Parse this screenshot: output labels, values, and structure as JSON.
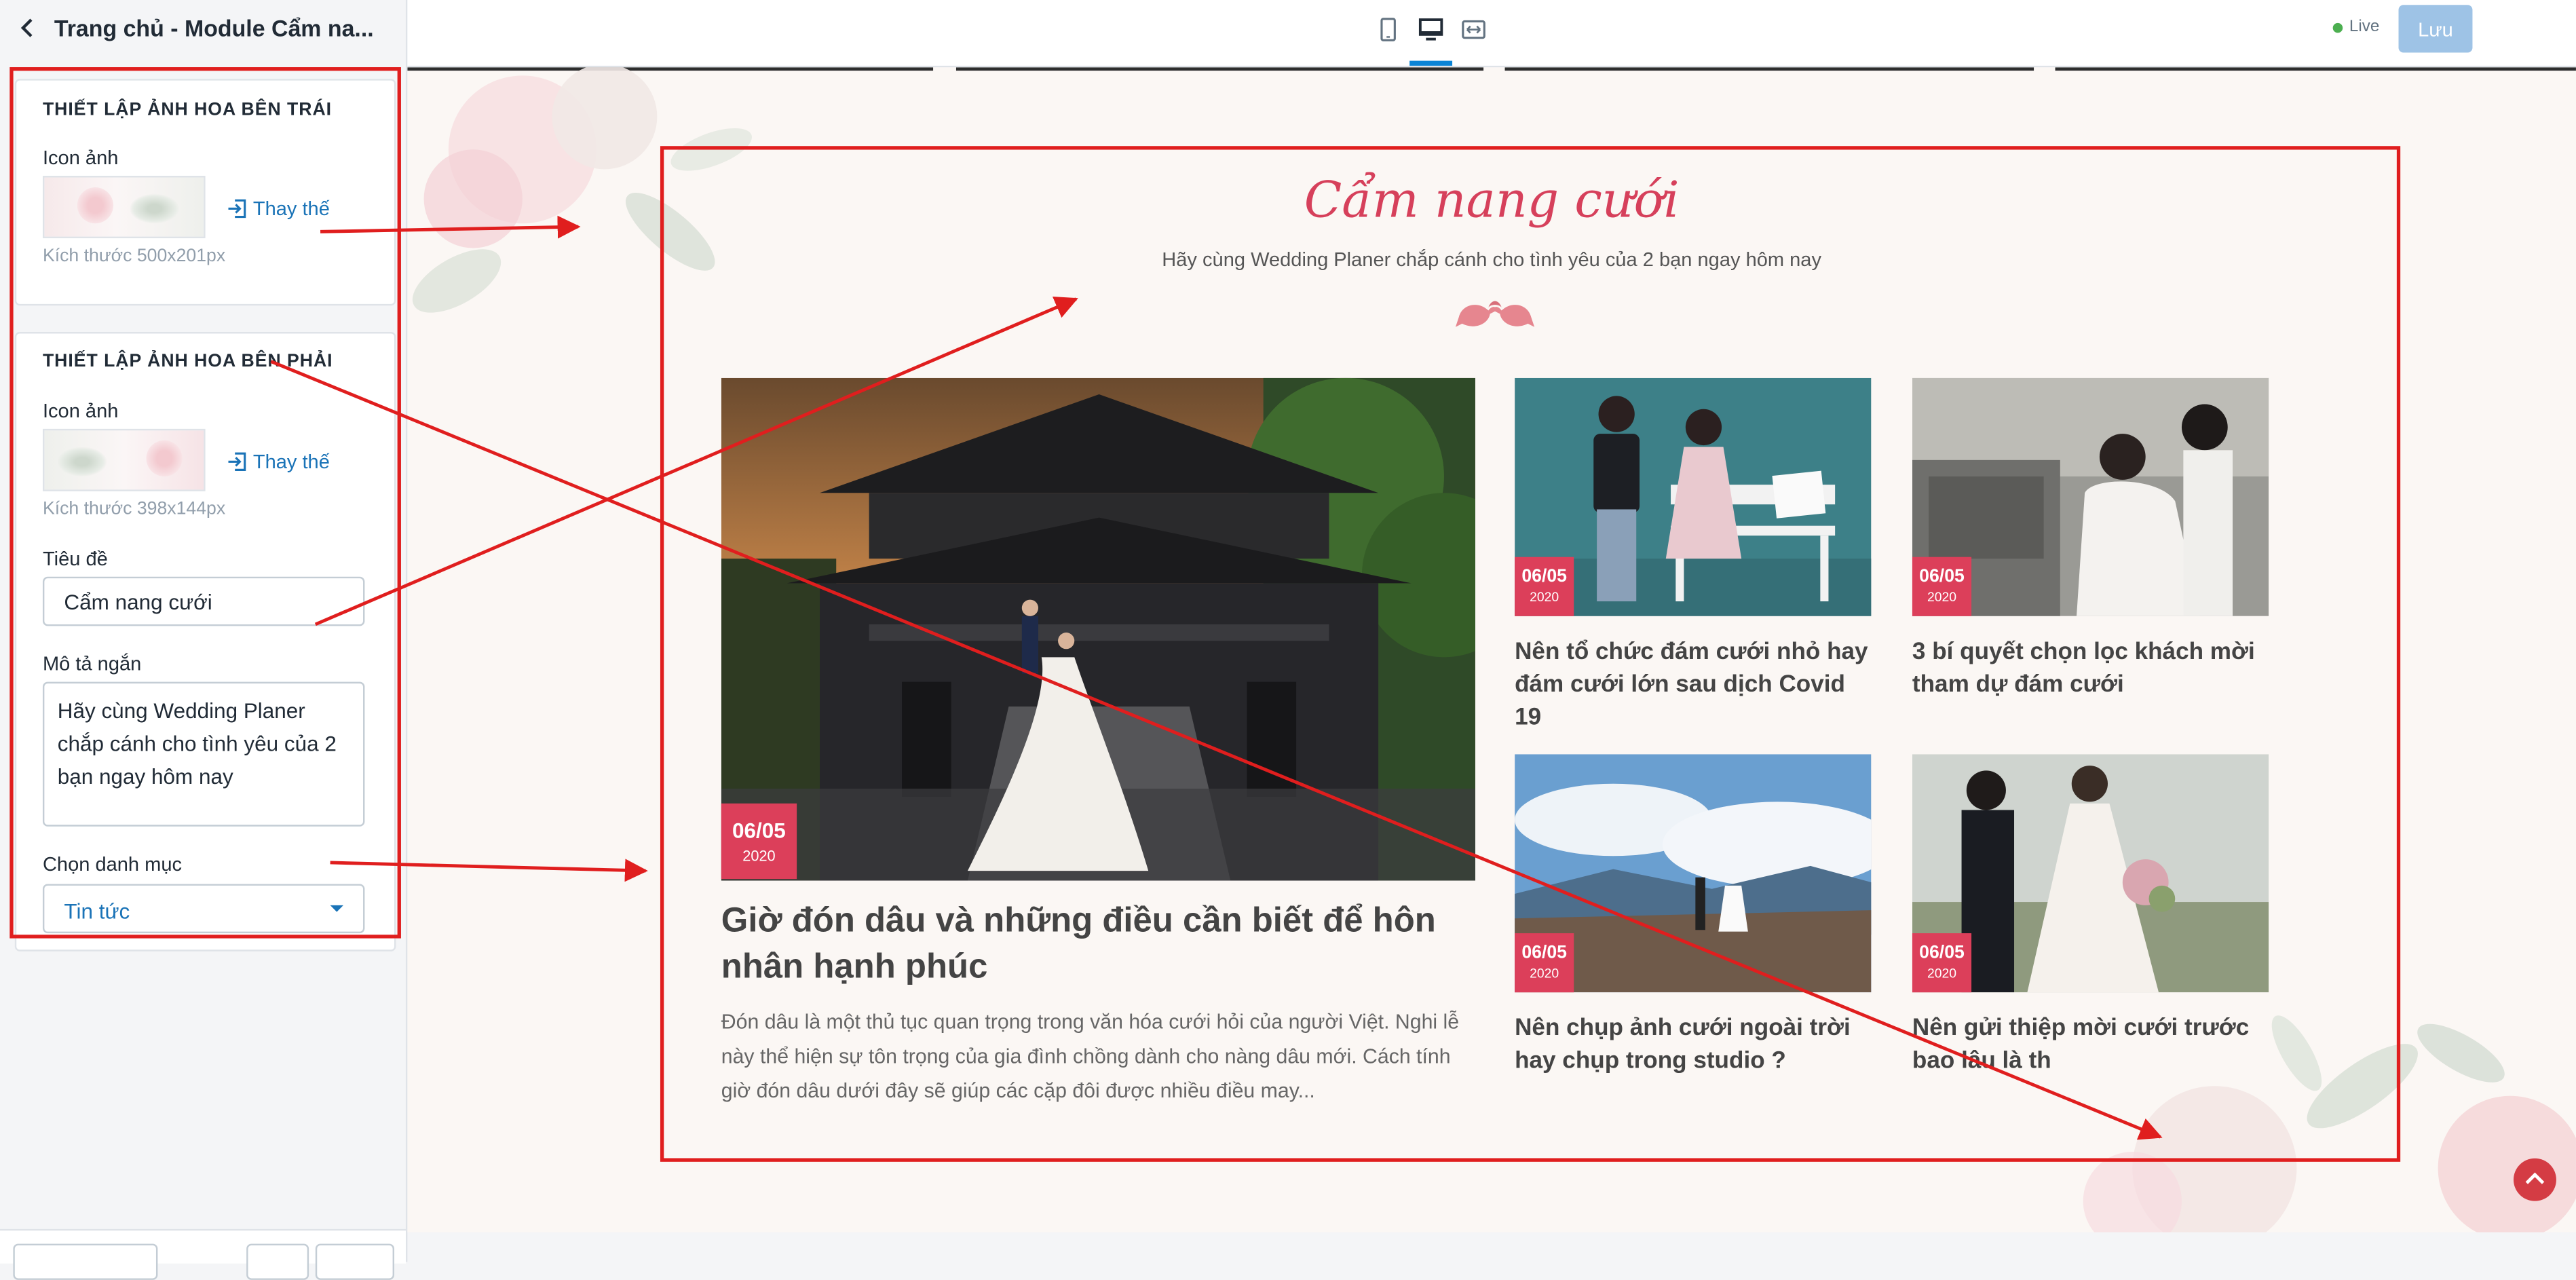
{
  "header": {
    "title": "Trang chủ - Module Cẩm na..."
  },
  "panel_left": {
    "heading": "THIẾT LẬP ẢNH HOA BÊN TRÁI",
    "icon_label": "Icon ảnh",
    "replace_label": "Thay thế",
    "size_hint": "Kích thước 500x201px"
  },
  "panel_right": {
    "heading": "THIẾT LẬP ẢNH HOA BÊN PHẢI",
    "icon_label": "Icon ảnh",
    "replace_label": "Thay thế",
    "size_hint": "Kích thước 398x144px",
    "title_label": "Tiêu đề",
    "title_value": "Cẩm nang cưới",
    "desc_label": "Mô tả ngắn",
    "desc_value": "Hãy cùng Wedding Planer chắp cánh cho tình yêu của 2 bạn ngay hôm nay",
    "category_label": "Chọn danh mục",
    "category_value": "Tin tức"
  },
  "topbar": {
    "live_label": "Live",
    "save_label": "Lưu"
  },
  "preview": {
    "title": "Cẩm nang cưới",
    "description": "Hãy cùng Wedding Planer chắp cánh cho tình yêu của 2 bạn ngay hôm nay",
    "featured": {
      "day": "06/05",
      "year": "2020",
      "title": "Giờ đón dâu và những điều cần biết để hôn nhân hạnh phúc",
      "excerpt": "Đón dâu là một thủ tục quan trọng trong văn hóa cưới hỏi của người Việt. Nghi lễ này thể hiện sự tôn trọng của gia đình chồng dành cho nàng dâu mới. Cách tính giờ đón dâu dưới đây sẽ giúp các cặp đôi được nhiều điều may..."
    },
    "posts": [
      {
        "day": "06/05",
        "year": "2020",
        "title": "Nên tổ chức đám cưới nhỏ hay đám cưới lớn sau dịch Covid 19"
      },
      {
        "day": "06/05",
        "year": "2020",
        "title": "3 bí quyết chọn lọc khách mời tham dự đám cưới"
      },
      {
        "day": "06/05",
        "year": "2020",
        "title": "Nên chụp ảnh cưới ngoài trời hay chụp trong studio ?"
      },
      {
        "day": "06/05",
        "year": "2020",
        "title": "Nên gửi thiệp mời cưới trước bao lâu là th"
      }
    ]
  },
  "colors": {
    "accent": "#dc3f5a",
    "link": "#1a73b7",
    "annotation": "#e01e1e",
    "save": "#9ec3e6"
  }
}
